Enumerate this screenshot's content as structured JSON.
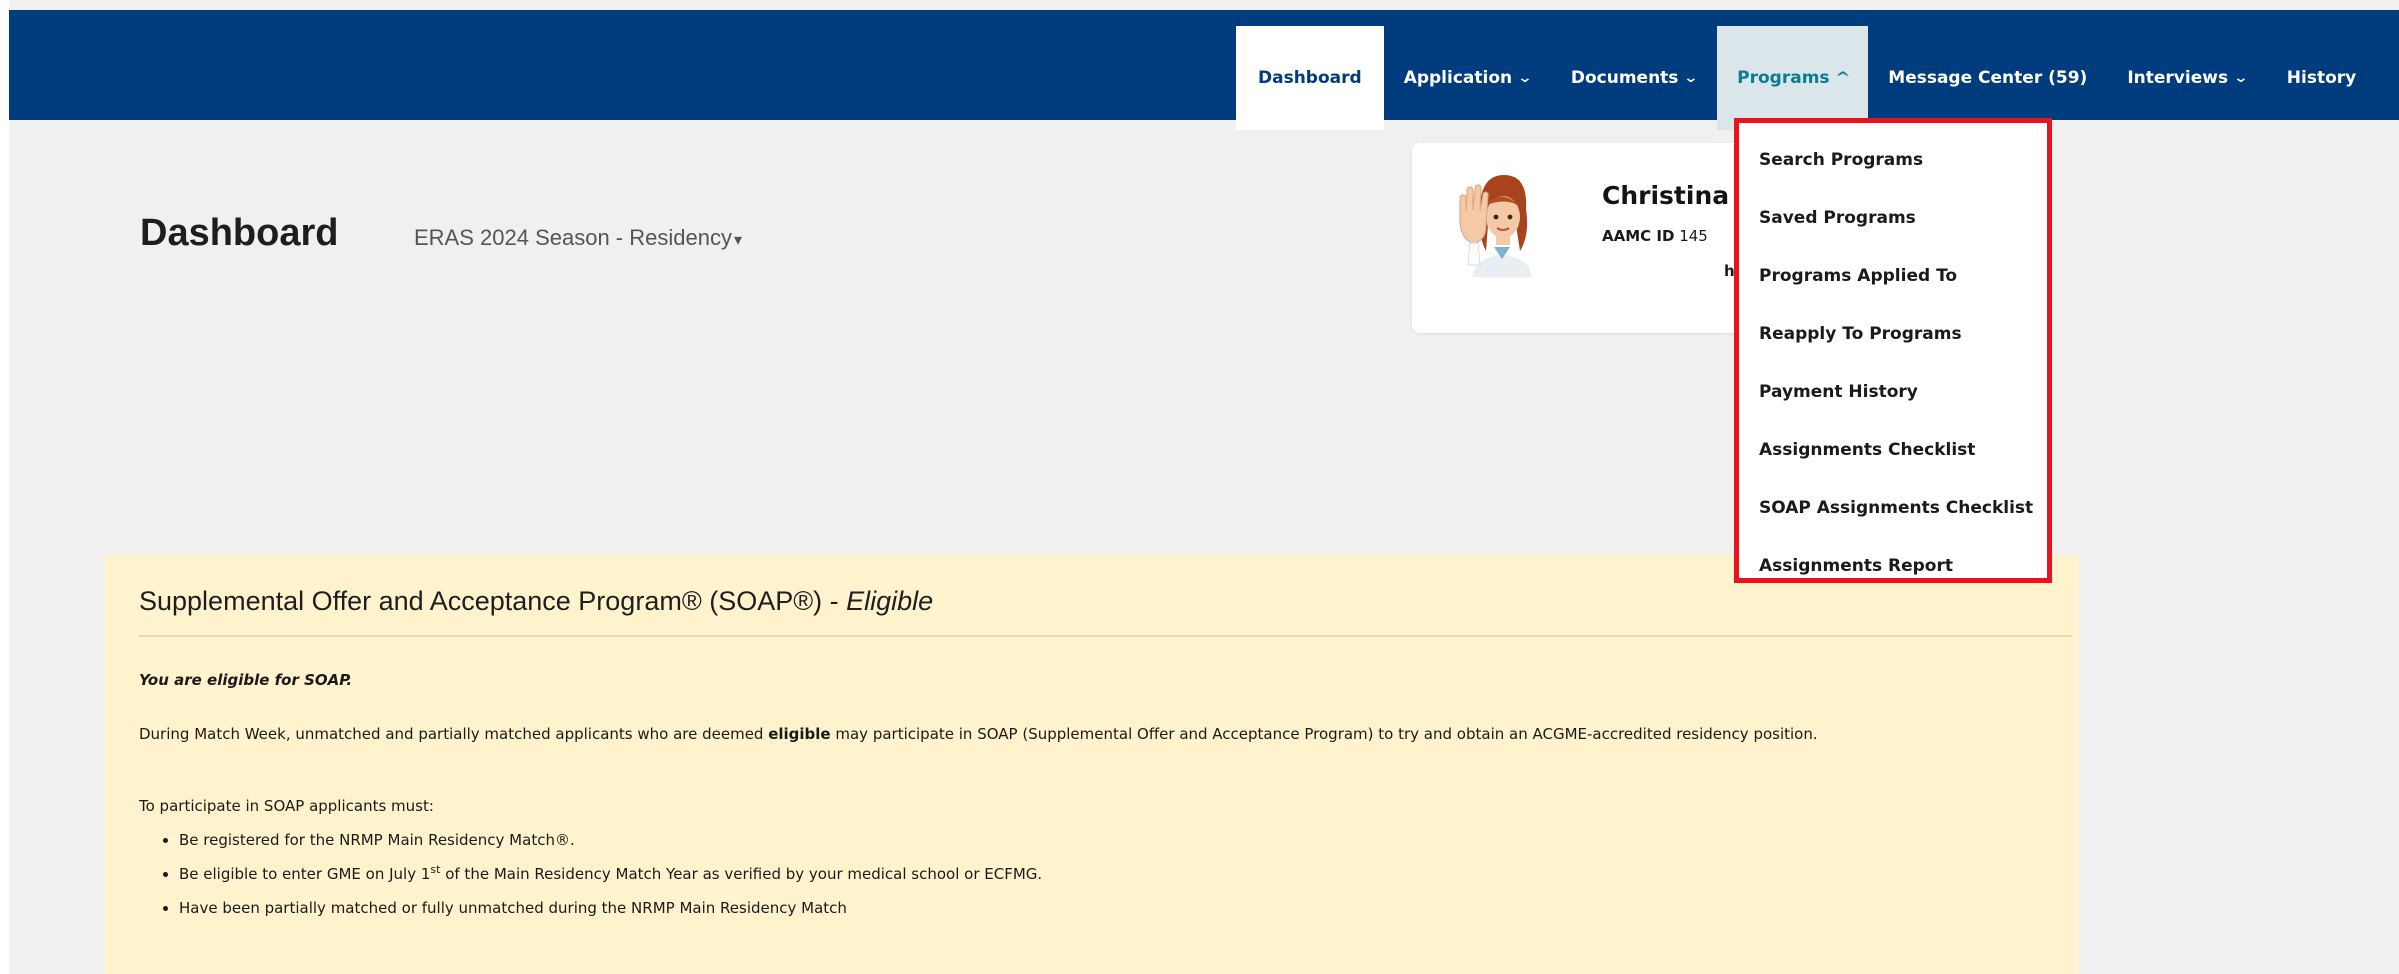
{
  "colors": {
    "header_bg": "#003c7e",
    "page_bg": "#f0f0f0",
    "soap_panel_bg": "#fff3cd",
    "dropdown_highlight_border": "#e8131c",
    "active_open_tab_text": "#0a7c95"
  },
  "nav": {
    "dashboard": "Dashboard",
    "application": "Application",
    "documents": "Documents",
    "programs": "Programs",
    "message_center": "Message Center (59)",
    "interviews": "Interviews",
    "history": "History",
    "chevron_down": "⌄",
    "chevron_up": "^"
  },
  "programs_menu": {
    "items": [
      "Search Programs",
      "Saved Programs",
      "Programs Applied To",
      "Reapply To Programs",
      "Payment History",
      "Assignments Checklist",
      "SOAP Assignments Checklist",
      "Assignments Report"
    ]
  },
  "page": {
    "title": "Dashboard",
    "season": "ERAS 2024 Season - Residency",
    "season_caret": "▾"
  },
  "profile": {
    "name": "Christina",
    "id_label": "AAMC ID",
    "id_partial": "145",
    "extra_char": "h",
    "avatar_icon": "doctor-avatar-icon"
  },
  "soap": {
    "title": "Supplemental Offer and Acceptance Program® (SOAP®) - ",
    "status": "Eligible",
    "eligible_line": "You are eligible for SOAP.",
    "para1_a": "During Match Week, unmatched and partially matched applicants who are deemed ",
    "para1_bold": "eligible",
    "para1_b": " may participate in SOAP (Supplemental Offer and Acceptance Program) to try and obtain an ACGME-accredited residency position.",
    "para2": "To participate in SOAP applicants must:",
    "bullet1": "Be registered for the NRMP Main Residency Match®.",
    "bullet2_a": "Be eligible to enter GME on July 1",
    "bullet2_sup": "st",
    "bullet2_b": " of the Main Residency Match Year as verified by your medical school or ECFMG.",
    "bullet3": "Have been partially matched or fully unmatched during the NRMP Main Residency Match"
  }
}
